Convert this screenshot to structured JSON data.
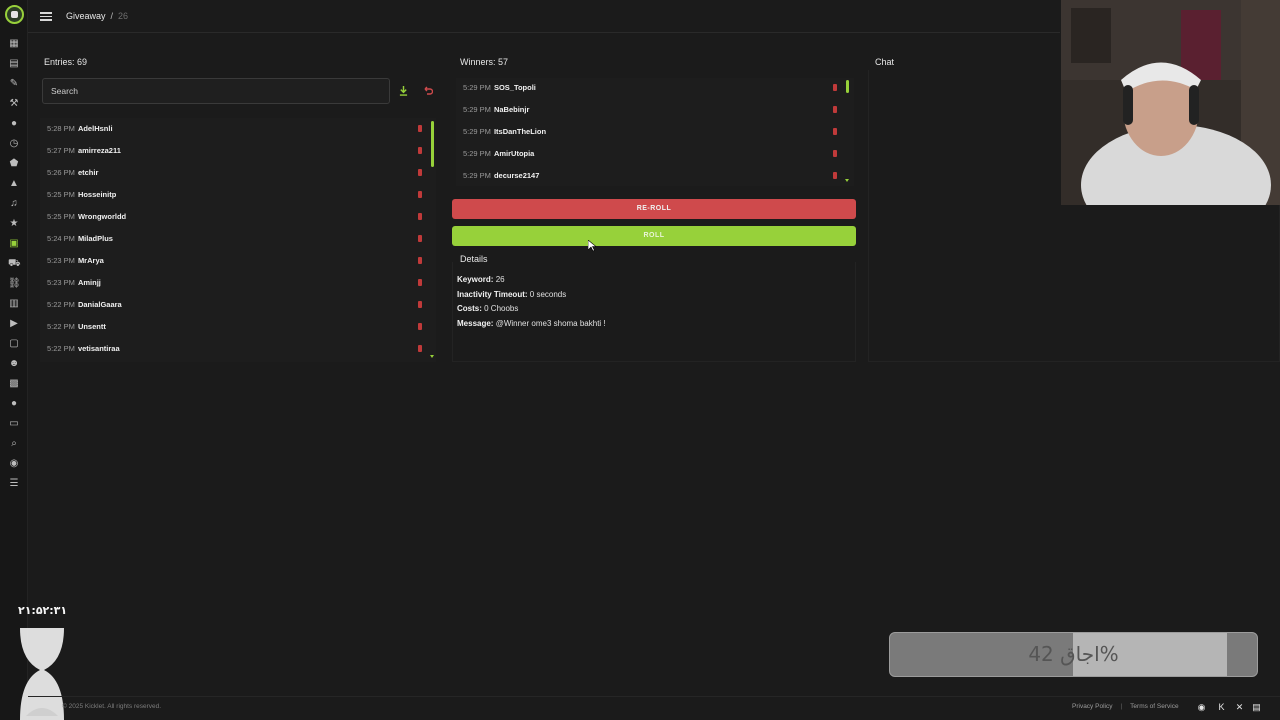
{
  "breadcrumb": {
    "section": "Giveaway",
    "separator": "/",
    "current": "26"
  },
  "entries": {
    "title": "Entries: 69",
    "search_placeholder": "Search",
    "items": [
      {
        "time": "5:28 PM",
        "user": "AdelHsnli"
      },
      {
        "time": "5:27 PM",
        "user": "amirreza211"
      },
      {
        "time": "5:26 PM",
        "user": "etchir"
      },
      {
        "time": "5:25 PM",
        "user": "Hosseinitp"
      },
      {
        "time": "5:25 PM",
        "user": "Wrongworldd"
      },
      {
        "time": "5:24 PM",
        "user": "MiladPlus"
      },
      {
        "time": "5:23 PM",
        "user": "MrArya"
      },
      {
        "time": "5:23 PM",
        "user": "Aminjj"
      },
      {
        "time": "5:22 PM",
        "user": "DanialGaara"
      },
      {
        "time": "5:22 PM",
        "user": "Unsentt"
      },
      {
        "time": "5:22 PM",
        "user": "vetisantiraa"
      }
    ]
  },
  "winners": {
    "title": "Winners: 57",
    "items": [
      {
        "time": "5:29 PM",
        "user": "SOS_Topoli"
      },
      {
        "time": "5:29 PM",
        "user": "NaBebinjr"
      },
      {
        "time": "5:29 PM",
        "user": "ItsDanTheLion"
      },
      {
        "time": "5:29 PM",
        "user": "AmirUtopia"
      },
      {
        "time": "5:29 PM",
        "user": "decurse2147"
      }
    ]
  },
  "buttons": {
    "reroll": "RE-ROLL",
    "roll": "ROLL"
  },
  "details": {
    "title": "Details",
    "keyword_label": "Keyword:",
    "keyword_value": "26",
    "timeout_label": "Inactivity Timeout:",
    "timeout_value": "0 seconds",
    "costs_label": "Costs:",
    "costs_value": "0 Choobs",
    "message_label": "Message:",
    "message_value": "@Winner ome3 shoma bakhti !"
  },
  "chat": {
    "title": "Chat"
  },
  "overlay": {
    "clock": "۲۱:۵۲:۳۱",
    "progress_label": "اجاق 42%",
    "progress_fraction": 0.42
  },
  "footer": {
    "copyright": "© 2025 Kicklet. All rights reserved.",
    "privacy": "Privacy Policy",
    "sep": "|",
    "terms": "Terms of Service"
  },
  "colors": {
    "accent": "#97d13a",
    "danger": "#cf4a4c",
    "background": "#1b1b1b"
  },
  "icons": {
    "sidebar": [
      "dashboard-icon",
      "document-icon",
      "pen-icon",
      "hammer-icon",
      "chat-icon",
      "clock-icon",
      "shield-icon",
      "triangle-icon",
      "music-icon",
      "star-icon",
      "gift-icon",
      "cart-icon",
      "link-icon",
      "chart-icon",
      "video-icon",
      "inbox-icon",
      "smile-icon",
      "film-icon",
      "comment-icon",
      "monitor-icon",
      "search-icon",
      "discord-icon",
      "list-icon"
    ]
  }
}
